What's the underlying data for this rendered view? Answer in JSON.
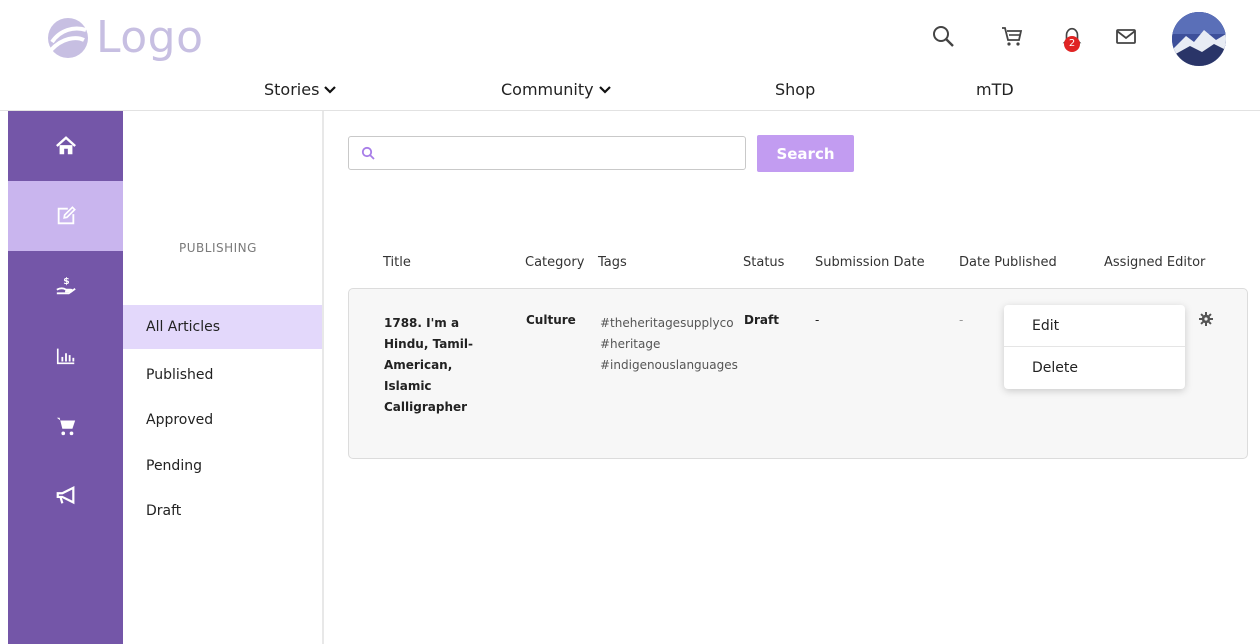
{
  "header": {
    "logo_text": "Logo",
    "icons": [
      "search-icon",
      "cart-icon",
      "bell-icon",
      "mail-icon"
    ],
    "notification_count": "2",
    "nav": [
      {
        "label": "Stories",
        "has_dropdown": true
      },
      {
        "label": "Community",
        "has_dropdown": true
      },
      {
        "label": "Shop",
        "has_dropdown": false
      },
      {
        "label": "mTD",
        "has_dropdown": false
      }
    ]
  },
  "rail": {
    "items": [
      "home-icon",
      "edit-icon",
      "earnings-icon",
      "analytics-icon",
      "cart-icon",
      "megaphone-icon"
    ],
    "active": "edit-icon"
  },
  "sidebar": {
    "section_title": "PUBLISHING",
    "items": [
      {
        "label": "All Articles",
        "active": true
      },
      {
        "label": "Published"
      },
      {
        "label": "Approved"
      },
      {
        "label": "Pending"
      },
      {
        "label": "Draft"
      }
    ]
  },
  "search": {
    "value": "",
    "placeholder": "",
    "button_label": "Search"
  },
  "table": {
    "columns": [
      "Title",
      "Category",
      "Tags",
      "Status",
      "Submission Date",
      "Date Published",
      "Assigned Editor"
    ],
    "rows": [
      {
        "title": "1788. I'm a Hindu, Tamil-American, Islamic Calligrapher",
        "category": "Culture",
        "tags": [
          "#theheritagesupplyco",
          "#heritage",
          "#indigenouslanguages"
        ],
        "status": "Draft",
        "submission_date": "-",
        "date_published": "-",
        "assigned_editor": ""
      }
    ]
  },
  "row_menu": {
    "items": [
      "Edit",
      "Delete"
    ]
  },
  "colors": {
    "rail": "#7456a8",
    "rail_active": "#c9b5ee",
    "sidebar_active": "#e3d8fb",
    "button": "#c29cf1",
    "logo": "#c7bfe2",
    "badge": "#e02424"
  }
}
